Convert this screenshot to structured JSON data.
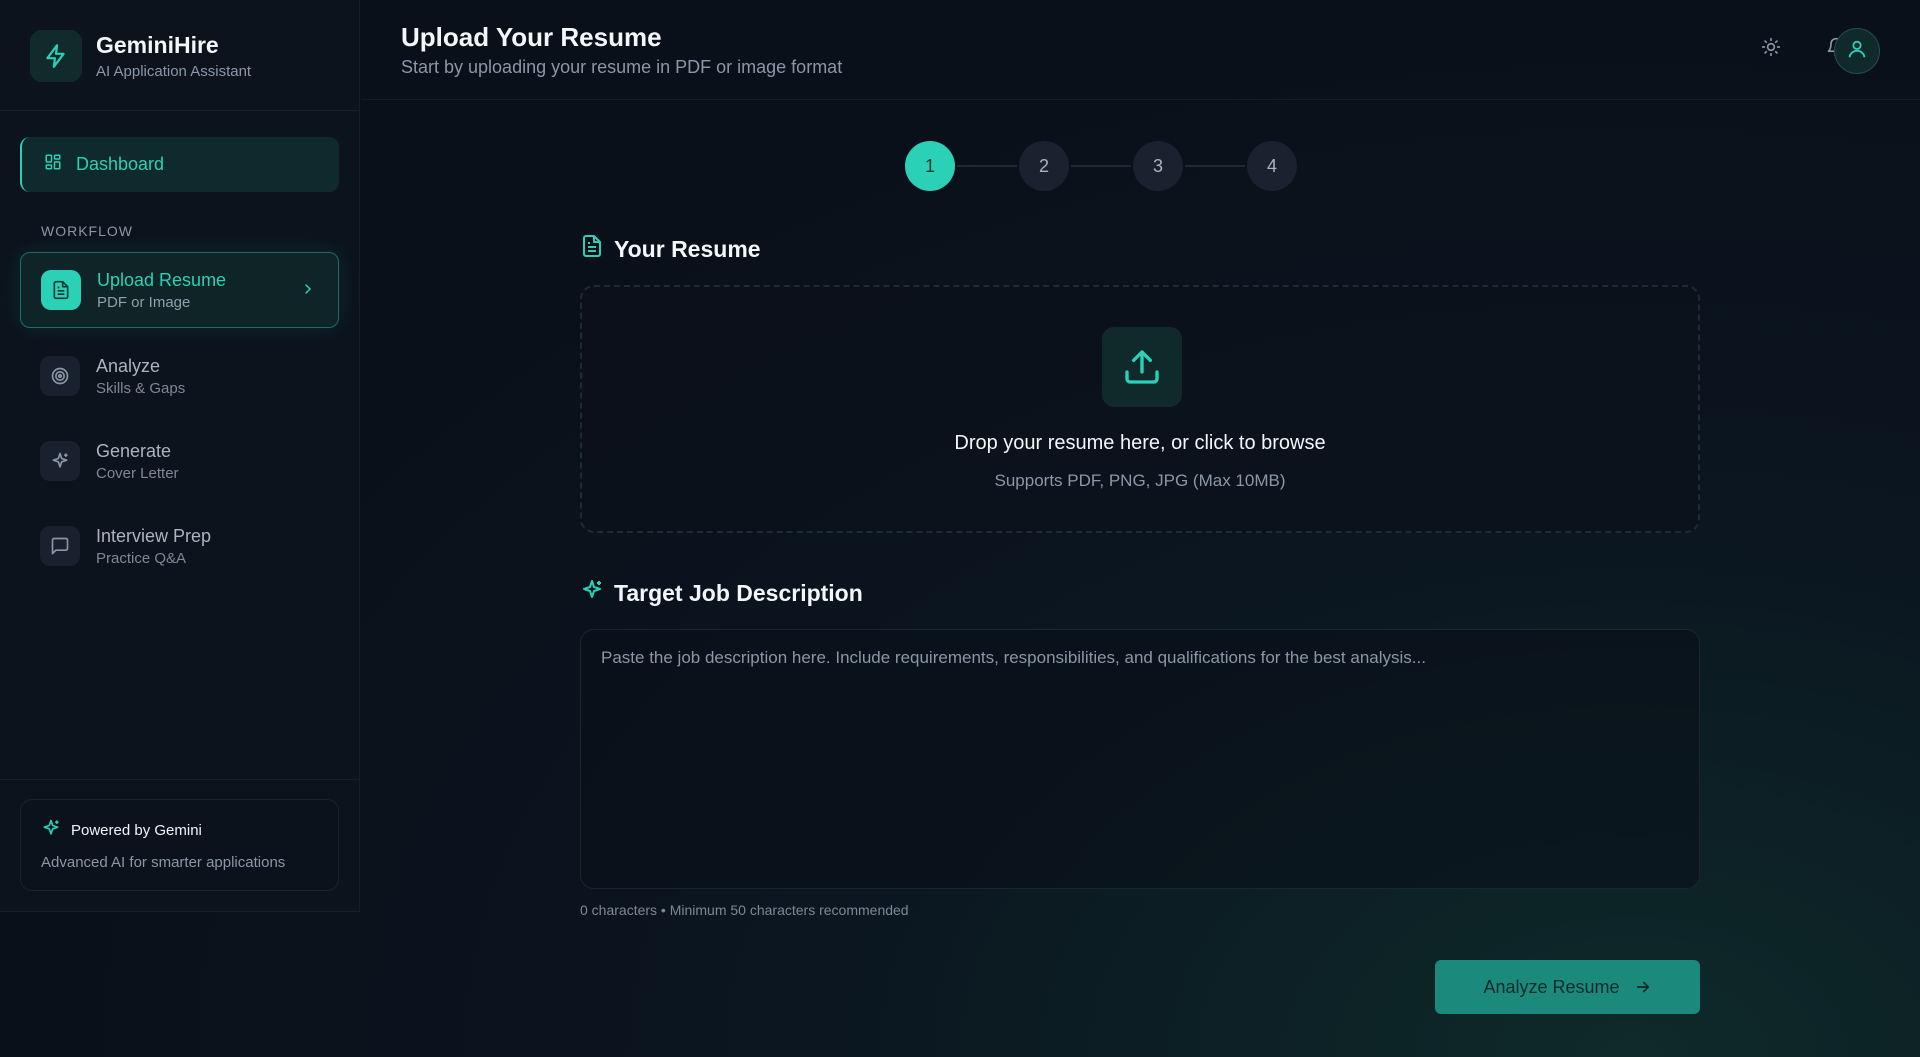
{
  "brand": {
    "name": "GeminiHire",
    "subtitle": "AI Application Assistant"
  },
  "sidebar": {
    "dashboard_label": "Dashboard",
    "section_label": "WORKFLOW",
    "items": [
      {
        "title": "Upload Resume",
        "subtitle": "PDF or Image",
        "icon": "file-icon",
        "active": true
      },
      {
        "title": "Analyze",
        "subtitle": "Skills & Gaps",
        "icon": "target-icon",
        "active": false
      },
      {
        "title": "Generate",
        "subtitle": "Cover Letter",
        "icon": "sparkle-icon",
        "active": false
      },
      {
        "title": "Interview Prep",
        "subtitle": "Practice Q&A",
        "icon": "chat-icon",
        "active": false
      }
    ],
    "powered": {
      "title": "Powered by Gemini",
      "subtitle": "Advanced AI for smarter applications"
    }
  },
  "header": {
    "title": "Upload Your Resume",
    "subtitle": "Start by uploading your resume in PDF or image format"
  },
  "stepper": {
    "steps": [
      "1",
      "2",
      "3",
      "4"
    ],
    "current": 1
  },
  "resume": {
    "title": "Your Resume",
    "drop_main": "Drop your resume here, or click to browse",
    "drop_sub": "Supports PDF, PNG, JPG (Max 10MB)"
  },
  "job": {
    "title": "Target Job Description",
    "placeholder": "Paste the job description here. Include requirements, responsibilities, and qualifications for the best analysis...",
    "char_count": "0 characters • Minimum 50 characters recommended"
  },
  "actions": {
    "analyze_label": "Analyze Resume"
  },
  "colors": {
    "accent": "#2ad1b6",
    "background": "#0b111b"
  }
}
